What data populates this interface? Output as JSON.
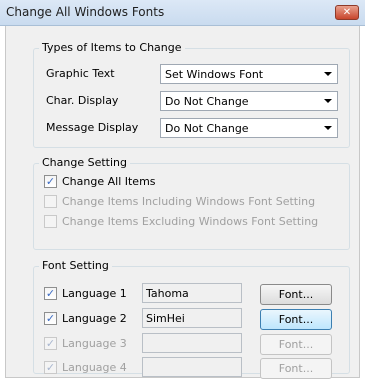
{
  "window": {
    "title": "Change All Windows Fonts",
    "close_label": "✕"
  },
  "types_group": {
    "legend": "Types of Items to Change",
    "rows": [
      {
        "label": "Graphic Text",
        "value": "Set Windows Font"
      },
      {
        "label": "Char. Display",
        "value": "Do Not Change"
      },
      {
        "label": "Message Display",
        "value": "Do Not Change"
      }
    ]
  },
  "change_group": {
    "legend": "Change Setting",
    "options": [
      {
        "label": "Change All Items",
        "checked": true,
        "enabled": true
      },
      {
        "label": "Change Items Including Windows Font Setting",
        "checked": false,
        "enabled": false
      },
      {
        "label": "Change Items Excluding Windows Font Setting",
        "checked": false,
        "enabled": false
      }
    ]
  },
  "font_group": {
    "legend": "Font Setting",
    "rows": [
      {
        "label": "Language 1",
        "font": "Tahoma",
        "button": "Font...",
        "checked": true,
        "enabled": true
      },
      {
        "label": "Language 2",
        "font": "SimHei",
        "button": "Font...",
        "checked": true,
        "enabled": true
      },
      {
        "label": "Language 3",
        "font": "",
        "button": "Font...",
        "checked": true,
        "enabled": false
      },
      {
        "label": "Language 4",
        "font": "",
        "button": "Font...",
        "checked": true,
        "enabled": false
      }
    ]
  },
  "check_glyph": "✓"
}
